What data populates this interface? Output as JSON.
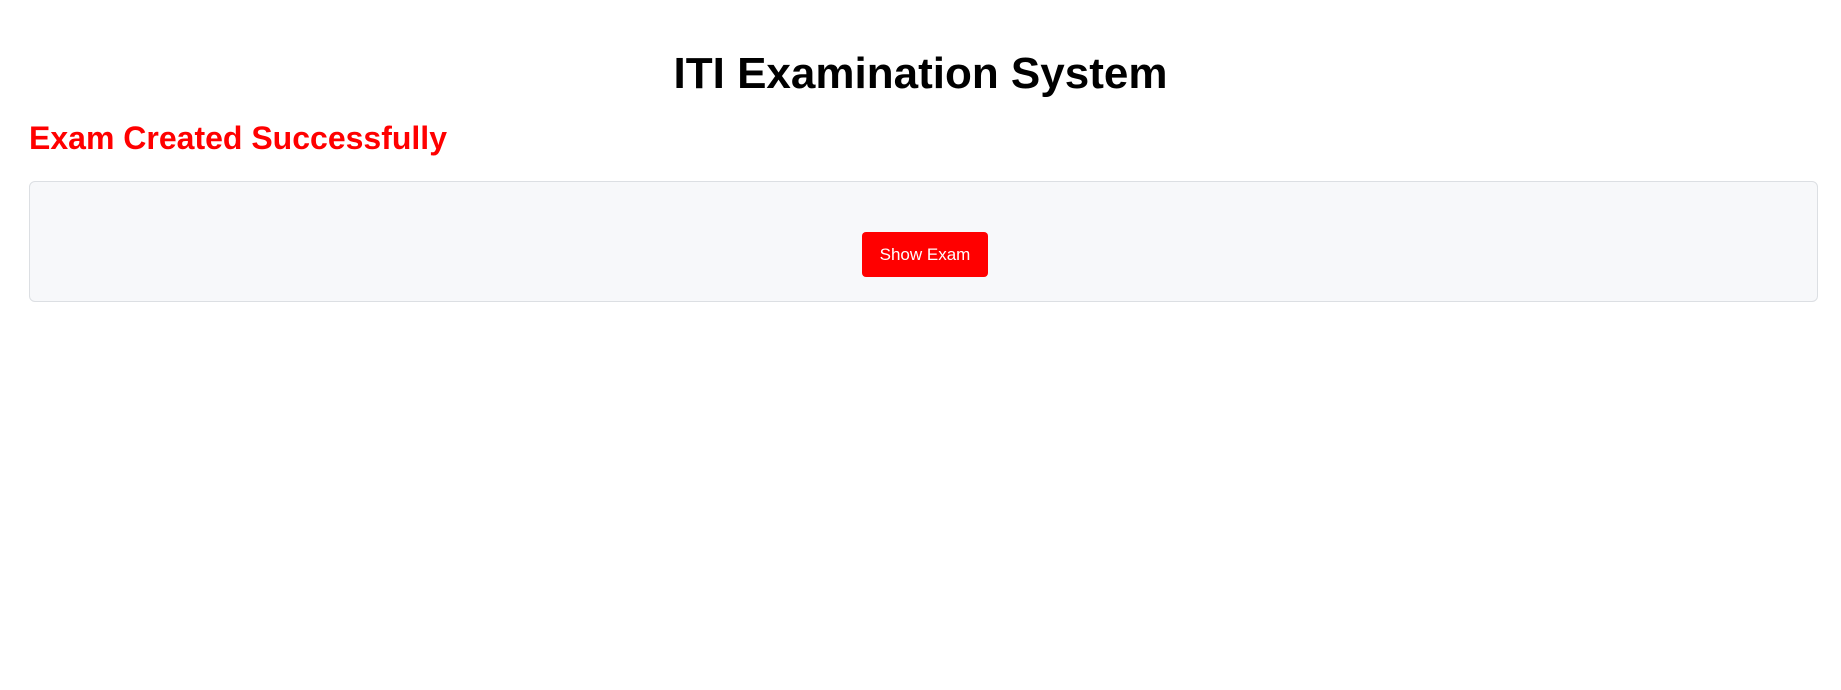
{
  "header": {
    "title": "ITI Examination System"
  },
  "status": {
    "message": "Exam Created Successfully",
    "color": "#ff0000"
  },
  "panel": {
    "show_exam_label": "Show Exam",
    "button_color": "#ff0000"
  }
}
